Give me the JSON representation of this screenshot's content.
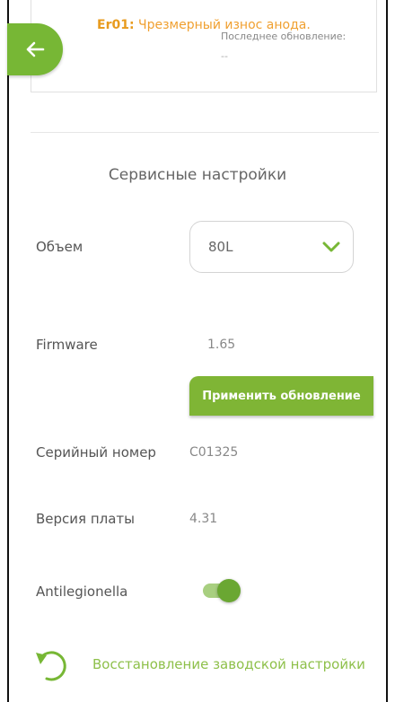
{
  "error": {
    "code": "Er01:",
    "message": " Чрезмерный износ анода."
  },
  "update": {
    "label": "Последнее обновление:",
    "value": "--"
  },
  "section_title": "Сервисные настройки",
  "volume": {
    "label": "Объем",
    "selected": "80L"
  },
  "firmware": {
    "label": "Firmware",
    "value": "1.65",
    "apply_label": "Применить обновление"
  },
  "serial": {
    "label": "Серийный номер",
    "value": "C01325"
  },
  "board": {
    "label": "Версия платы",
    "value": "4.31"
  },
  "antilegionella": {
    "label": "Antilegionella",
    "enabled": true
  },
  "reset": {
    "label": "Восстановление заводской настройки"
  },
  "colors": {
    "accent": "#77b735",
    "warning": "#f0a030"
  }
}
